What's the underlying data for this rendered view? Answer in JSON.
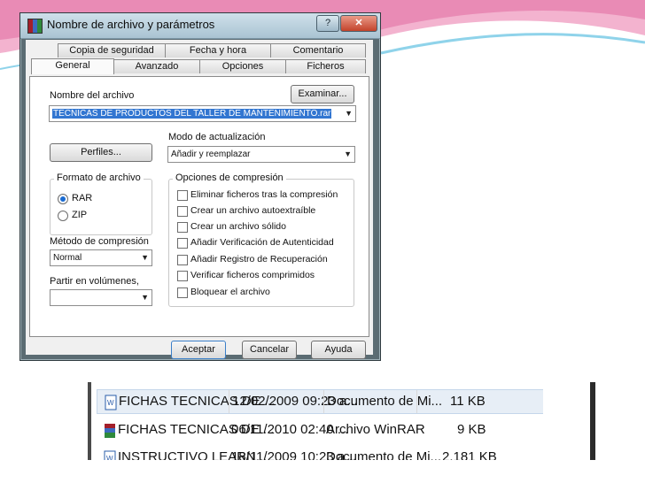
{
  "dialog": {
    "title": "Nombre de archivo y parámetros",
    "help_button": "?",
    "close_button": "✕",
    "tabs_back": [
      "Copia de seguridad",
      "Fecha y hora",
      "Comentario"
    ],
    "tabs_front": [
      "General",
      "Avanzado",
      "Opciones",
      "Ficheros"
    ],
    "archive_name_label": "Nombre del archivo",
    "browse_button": "Examinar...",
    "archive_name_value": "TECNICAS DE PRODUCTOS DEL TALLER DE MANTENIMIENTO.rar",
    "profiles_button": "Perfiles...",
    "update_mode_label": "Modo de actualización",
    "update_mode_value": "Añadir y reemplazar",
    "format_group_title": "Formato de archivo",
    "format_options": [
      "RAR",
      "ZIP"
    ],
    "format_selected": "RAR",
    "compression_method_label": "Método de compresión",
    "compression_method_value": "Normal",
    "split_label": "Partir en volúmenes,",
    "split_value": "",
    "options_group_title": "Opciones de compresión",
    "options": [
      "Eliminar ficheros tras la compresión",
      "Crear un archivo autoextraíble",
      "Crear un archivo sólido",
      "Añadir Verificación de Autenticidad",
      "Añadir Registro de Recuperación",
      "Verificar ficheros comprimidos",
      "Bloquear el archivo"
    ],
    "ok_button": "Aceptar",
    "cancel_button": "Cancelar",
    "help_text_button": "Ayuda"
  },
  "files": [
    {
      "name": "FICHAS TECNICAS DE ...",
      "date": "12/02/2009 09:23 a...",
      "type": "Documento de Mi...",
      "size": "11 KB"
    },
    {
      "name": "FICHAS TECNICAS DE ...",
      "date": "06/11/2010 02:40 ...",
      "type": "Archivo WinRAR",
      "size": "9 KB"
    },
    {
      "name": "INSTRUCTIVO LEARN...",
      "date": "18/11/2009 10:23 a...",
      "type": "Documento de Mi...",
      "size": "2.181 KB"
    }
  ],
  "colors": {
    "selection": "#3276d1",
    "wave_pink": "#e98bb5",
    "wave_blue": "#8fd3ea"
  }
}
